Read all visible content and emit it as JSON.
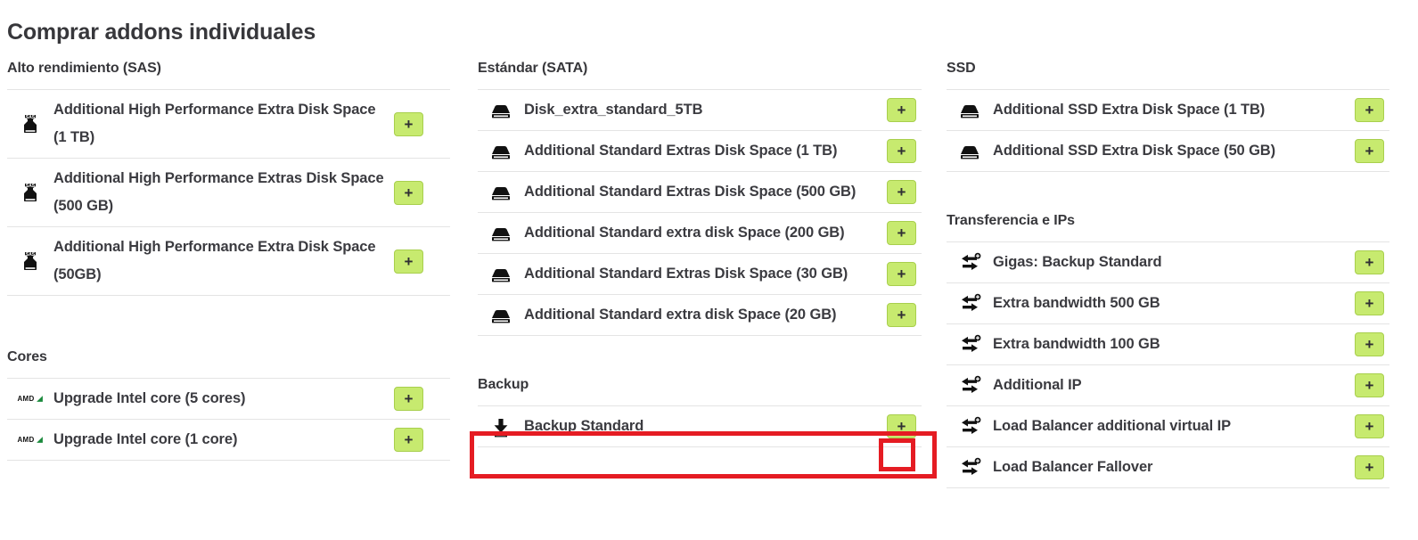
{
  "page": {
    "title": "Comprar addons individuales",
    "accent_green": "#c7ea6f",
    "accent_green_border": "#a8cf4d",
    "highlight_red": "#e51c23",
    "text_color": "#3b3b40",
    "add_button_label": "+"
  },
  "columns": [
    {
      "id": "left",
      "sections": [
        {
          "id": "alto-rendimiento-sas",
          "heading": "Alto rendimiento (SAS)",
          "icon": "sas-disk-icon",
          "rows": [
            {
              "label": "Additional High Performance Extra Disk Space (1 TB)",
              "add_label": "+"
            },
            {
              "label": "Additional High Performance Extras Disk Space (500 GB)",
              "add_label": "+"
            },
            {
              "label": "Additional High Performance Extra Disk Space (50GB)",
              "add_label": "+"
            }
          ]
        },
        {
          "id": "cores",
          "heading": "Cores",
          "icon": "amd-logo-icon",
          "rows": [
            {
              "label": "Upgrade Intel core (5 cores)",
              "add_label": "+"
            },
            {
              "label": "Upgrade Intel core (1 core)",
              "add_label": "+"
            }
          ]
        }
      ]
    },
    {
      "id": "middle",
      "sections": [
        {
          "id": "estandar-sata",
          "heading": "Estándar (SATA)",
          "icon": "hard-disk-icon",
          "rows": [
            {
              "label": "Disk_extra_standard_5TB",
              "add_label": "+"
            },
            {
              "label": "Additional Standard Extras Disk Space (1 TB)",
              "add_label": "+"
            },
            {
              "label": "Additional Standard Extras Disk Space (500 GB)",
              "add_label": "+"
            },
            {
              "label": "Additional Standard extra disk Space (200 GB)",
              "add_label": "+"
            },
            {
              "label": "Additional Standard Extras Disk Space (30 GB)",
              "add_label": "+"
            },
            {
              "label": "Additional Standard extra disk Space (20 GB)",
              "add_label": "+"
            }
          ]
        },
        {
          "id": "backup",
          "heading": "Backup",
          "icon": "backup-download-icon",
          "rows": [
            {
              "label": "Backup Standard",
              "add_label": "+",
              "highlighted": true
            }
          ]
        }
      ]
    },
    {
      "id": "right",
      "sections": [
        {
          "id": "ssd",
          "heading": "SSD",
          "icon": "hard-disk-icon",
          "rows": [
            {
              "label": "Additional SSD Extra Disk Space (1 TB)",
              "add_label": "+"
            },
            {
              "label": "Additional SSD Extra Disk Space (50 GB)",
              "add_label": "+"
            }
          ]
        },
        {
          "id": "transferencia-e-ips",
          "heading": "Transferencia e IPs",
          "icon": "transfer-arrows-icon",
          "rows": [
            {
              "label": "Gigas: Backup Standard",
              "add_label": "+"
            },
            {
              "label": "Extra bandwidth 500 GB",
              "add_label": "+"
            },
            {
              "label": "Extra bandwidth 100 GB",
              "add_label": "+"
            },
            {
              "label": "Additional IP",
              "add_label": "+"
            },
            {
              "label": "Load Balancer additional virtual IP",
              "add_label": "+"
            },
            {
              "label": "Load Balancer Fallover",
              "add_label": "+"
            }
          ]
        }
      ]
    }
  ]
}
